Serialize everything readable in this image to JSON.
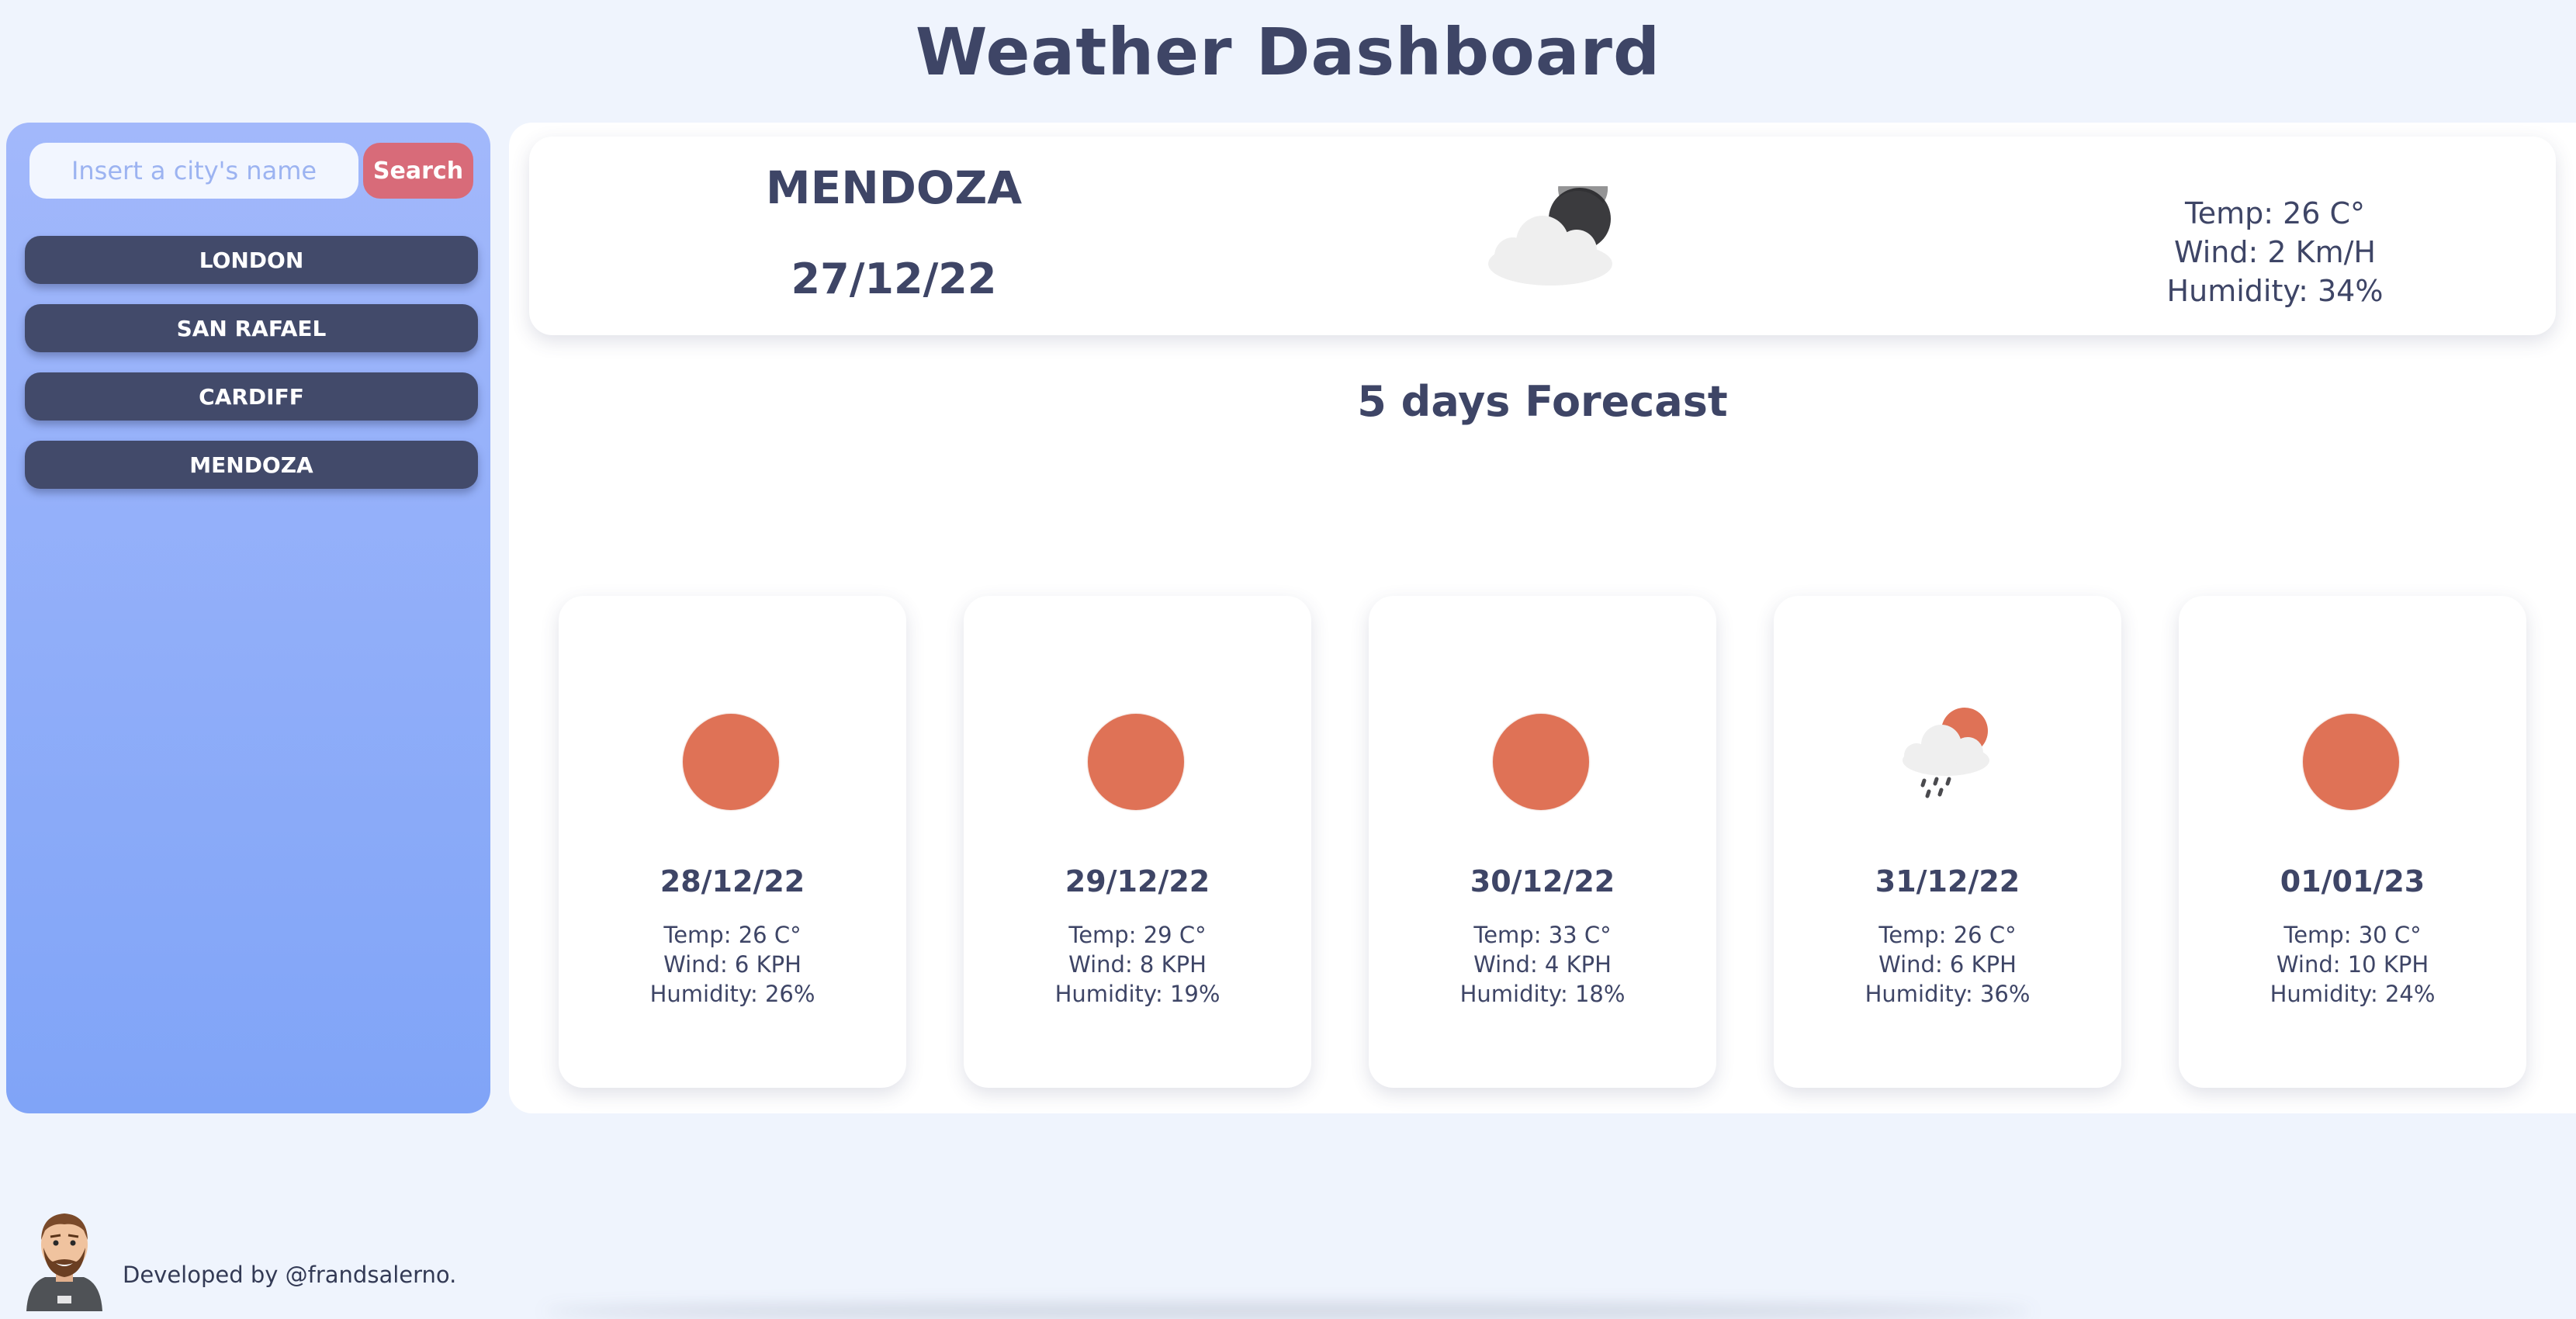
{
  "header": {
    "title": "Weather Dashboard"
  },
  "search": {
    "placeholder": "Insert a city's name",
    "button_label": "Search"
  },
  "history": {
    "cities": [
      "LONDON",
      "SAN RAFAEL",
      "CARDIFF",
      "MENDOZA"
    ]
  },
  "current": {
    "city": "MENDOZA",
    "date": "27/12/22",
    "icon": "partly-cloudy-night-icon",
    "temp": "Temp: 26 C°",
    "wind": "Wind: 2 Km/H",
    "humidity": "Humidity: 34%"
  },
  "forecast": {
    "title": "5 days Forecast",
    "days": [
      {
        "date": "28/12/22",
        "icon": "sun-icon",
        "temp": "Temp: 26 C°",
        "wind": "Wind: 6 KPH",
        "humidity": "Humidity: 26%"
      },
      {
        "date": "29/12/22",
        "icon": "sun-icon",
        "temp": "Temp: 29 C°",
        "wind": "Wind: 8 KPH",
        "humidity": "Humidity: 19%"
      },
      {
        "date": "30/12/22",
        "icon": "sun-icon",
        "temp": "Temp: 33 C°",
        "wind": "Wind: 4 KPH",
        "humidity": "Humidity: 18%"
      },
      {
        "date": "31/12/22",
        "icon": "rain-sun-cloud-icon",
        "temp": "Temp: 26 C°",
        "wind": "Wind: 6 KPH",
        "humidity": "Humidity: 36%"
      },
      {
        "date": "01/01/23",
        "icon": "sun-icon",
        "temp": "Temp: 30 C°",
        "wind": "Wind: 10 KPH",
        "humidity": "Humidity: 24%"
      }
    ]
  },
  "footer": {
    "text": "Developed by @frandsalerno."
  },
  "colors": {
    "background": "#eff4fd",
    "text": "#3e4566",
    "sidebar_top": "#a2b8fb",
    "sidebar_bottom": "#80a4f7",
    "search_button": "#d86b79",
    "city_button": "#424a6a",
    "sun": "#df7256"
  }
}
